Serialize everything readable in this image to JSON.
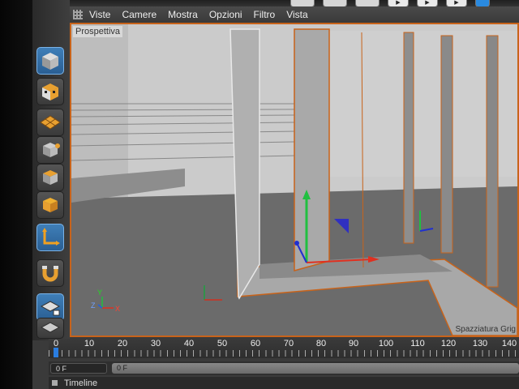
{
  "menu": {
    "items": [
      "Viste",
      "Camere",
      "Mostra",
      "Opzioni",
      "Filtro",
      "Vista"
    ]
  },
  "viewport": {
    "label": "Prospettiva",
    "grid_text": "Spazziatura Grig",
    "axis_y": "Y",
    "axis_z": "Z",
    "axis_x": "X"
  },
  "left_tools": [
    {
      "icon": "model-cube-icon",
      "active": true
    },
    {
      "icon": "texture-checker-icon",
      "active": false
    },
    {
      "icon": "workplane-grid-icon",
      "active": false
    },
    {
      "icon": "points-mode-icon",
      "active": false
    },
    {
      "icon": "edges-mode-icon",
      "active": false
    },
    {
      "icon": "polygons-mode-icon",
      "active": false
    },
    {
      "icon": "axis-enable-icon",
      "active": true
    },
    {
      "icon": "snap-magnet-icon",
      "active": false
    },
    {
      "icon": "locked-workplane-icon",
      "active": true
    },
    {
      "icon": "planar-workplane-icon",
      "active": false
    }
  ],
  "timeline": {
    "ticks": [
      "0",
      "10",
      "20",
      "30",
      "40",
      "50",
      "60",
      "70",
      "80",
      "90",
      "100",
      "110",
      "120",
      "130",
      "140"
    ],
    "start_frame": "0 F",
    "current_frame": "0 F",
    "label": "Timeline"
  },
  "colors": {
    "selection": "#c8631a",
    "accent": "#2a7de0"
  }
}
